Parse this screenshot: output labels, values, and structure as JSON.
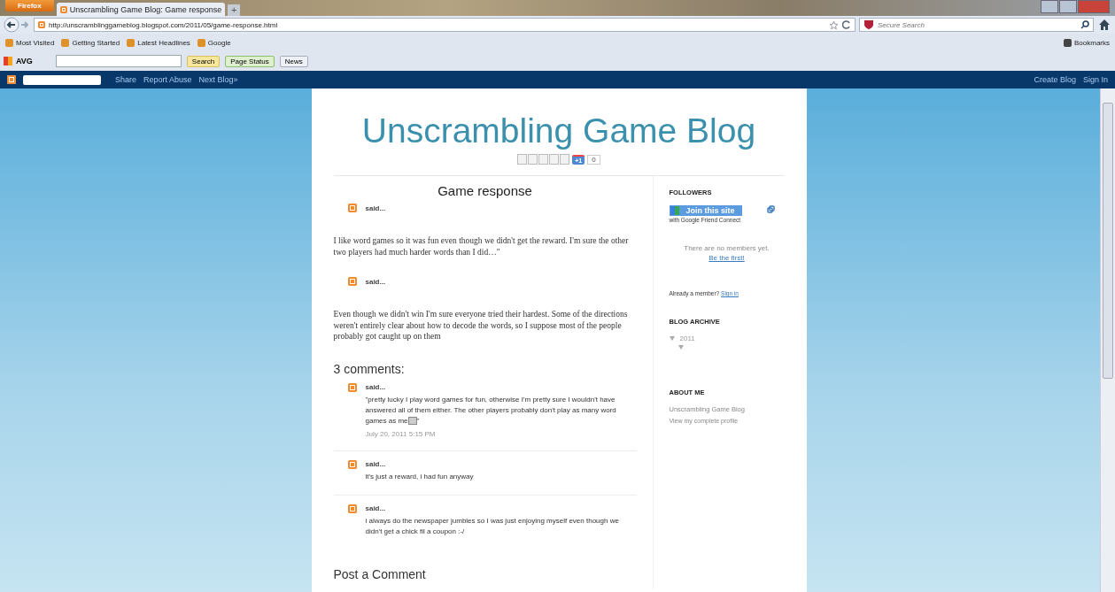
{
  "browser": {
    "menu_button": "Firefox",
    "tabs": [
      {
        "title": "Unscrambling Game Blog: Game response",
        "selected": true
      }
    ],
    "new_tab": "+",
    "url": "http://unscramblinggameblog.blogspot.com/2011/05/game-response.html",
    "search_placeholder": "Secure Search",
    "bookmarks": [
      "Most Visited",
      "Getting Started",
      "Latest Headlines",
      "Google"
    ],
    "bookmarks_menu": "Bookmarks",
    "toolbar": {
      "brand": "AVG",
      "search_button": "Search",
      "page_status": "Page Status",
      "news": "News"
    }
  },
  "navbar": {
    "links": [
      "Share",
      "Report Abuse",
      "Next Blog»"
    ],
    "right_links": [
      "Create Blog",
      "Sign In"
    ]
  },
  "blog": {
    "title": "Unscrambling Game Blog",
    "plus_one": "+1",
    "plus_count": "0"
  },
  "post": {
    "title": "Game response",
    "entries": [
      {
        "author": "said...",
        "text": "I like word games so it was fun even though we didn't get the reward.  I'm sure the other two players had much harder words than I did…\""
      },
      {
        "author": "said...",
        "text": "Even though we didn't win I'm sure everyone tried their hardest.  Some of the directions weren't entirely clear about how to decode the words, so I suppose most of the people probably got caught up on them"
      }
    ]
  },
  "comments_heading": "3 comments:",
  "comments": [
    {
      "author": "said...",
      "text": "\"pretty lucky I play word games for fun, otherwise I'm pretty sure I wouldn't have answered all of them either. The other players probably don't play as many word games as me",
      "emoticon": true,
      "text_end": "\"",
      "timestamp": "July 20, 2011 5:15 PM"
    },
    {
      "author": "said...",
      "text": "it's just a reward, i had fun anyway",
      "emoticon": false
    },
    {
      "author": "said...",
      "text": "i always do the newspaper jumbles so I was just enjoying myself even though we didn't get a chick fil a coupon :-/",
      "emoticon": false
    }
  ],
  "post_comment_heading": "Post a Comment",
  "sidebar": {
    "followers": {
      "title": "FOLLOWERS",
      "join_button": "Join this site",
      "join_caption": "with Google Friend Connect",
      "empty_text": "There are no members yet.",
      "first_link": "Be the first!",
      "member_text": "Already a member?",
      "sign_in": "Sign in"
    },
    "archive": {
      "title": "BLOG ARCHIVE",
      "items": [
        {
          "label": "2011",
          "expanded": true,
          "children": [
            {
              "expanded": true
            }
          ]
        }
      ]
    },
    "about": {
      "title": "ABOUT ME",
      "name": "Unscrambling Game Blog",
      "profile_link": "View my complete profile"
    }
  }
}
